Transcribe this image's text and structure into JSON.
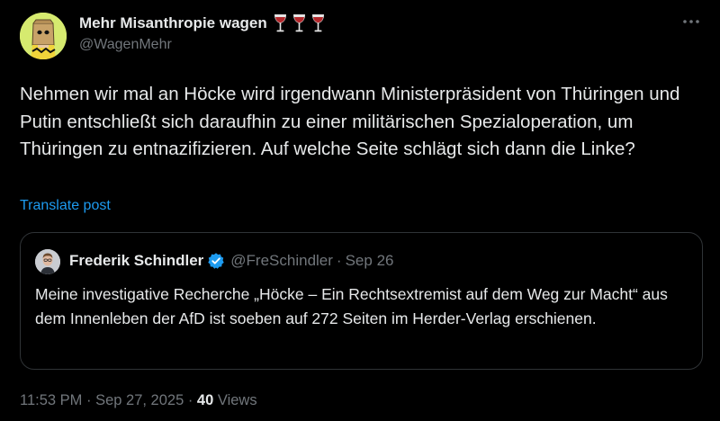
{
  "author": {
    "display_name": "Mehr Misanthropie wagen",
    "handle": "@WagenMehr",
    "name_emojis": [
      "wine-glass-icon",
      "wine-glass-icon",
      "wine-glass-icon"
    ]
  },
  "post": {
    "text": "Nehmen wir mal an Höcke wird irgendwann Ministerpräsident von Thüringen und Putin entschließt sich daraufhin zu einer militärischen Spezialoperation, um Thüringen zu entnazifizieren. Auf welche Seite schlägt sich dann die Linke?",
    "translate_label": "Translate post"
  },
  "quote": {
    "display_name": "Frederik Schindler",
    "handle": "@FreSchindler",
    "separator": "·",
    "date": "Sep 26",
    "text": "Meine investigative Recherche „Höcke – Ein Rechtsextremist auf dem Weg zur Macht“ aus dem Innenleben der AfD ist soeben auf 272 Seiten im Herder-Verlag erschienen."
  },
  "meta": {
    "time": "11:53 PM",
    "separator": " · ",
    "date": "Sep 27, 2025",
    "views_count": "40",
    "views_label": "Views"
  },
  "colors": {
    "background": "#000000",
    "text_primary": "#e7e9ea",
    "text_secondary": "#71767b",
    "link": "#1d9bf0",
    "border": "#2f3336",
    "verified": "#1d9bf0"
  }
}
